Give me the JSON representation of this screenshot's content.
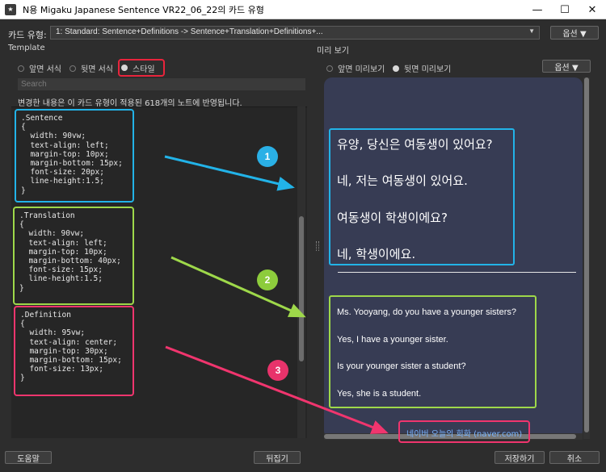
{
  "window": {
    "title": "N용 Migaku Japanese Sentence VR22_06_22의 카드 유형",
    "minimize": "—",
    "maximize": "☐",
    "close": "✕"
  },
  "note_type": {
    "label": "카드 유형:",
    "value": "1: Standard: Sentence+Definitions -> Sentence+Translation+Definitions+...",
    "options_button": "옵션 ▼"
  },
  "template": {
    "section_label": "Template",
    "radios": [
      "앞면 서식",
      "뒷면 서식",
      "스타일"
    ],
    "selected_radio": 2,
    "search_placeholder": "Search",
    "hint": "변경한 내용은 이 카드 유형이 적용된 618개의 노트에 반영됩니다.",
    "css_blocks": [
      {
        "selector": ".Sentence",
        "lines": [
          "{",
          "  width: 90vw;",
          "  text-align: left;",
          "  margin-top: 10px;",
          "  margin-bottom: 15px;",
          "  font-size: 20px;",
          "  line-height:1.5;",
          "}"
        ]
      },
      {
        "selector": ".Translation",
        "lines": [
          "{",
          "  width: 90vw;",
          "  text-align: left;",
          "  margin-top: 10px;",
          "  margin-bottom: 40px;",
          "  font-size: 15px;",
          "  line-height:1.5;",
          "}"
        ]
      },
      {
        "selector": ".Definition",
        "lines": [
          "{",
          "  width: 95vw;",
          "  text-align: center;",
          "  margin-top: 30px;",
          "  margin-bottom: 15px;",
          "  font-size: 13px;",
          "}"
        ]
      }
    ]
  },
  "preview": {
    "section_label": "미리 보기",
    "radios": [
      "앞면 미리보기",
      "뒷면 미리보기"
    ],
    "selected_radio": 1,
    "options_button": "옵션 ▼",
    "sentences": [
      "유양, 당신은 여동생이 있어요?",
      "네, 저는 여동생이 있어요.",
      "여동생이 학생이에요?",
      "네, 학생이에요."
    ],
    "translations": [
      "Ms. Yooyang, do you have a younger sisters?",
      "Yes, I have a younger sister.",
      "Is your younger sister a student?",
      "Yes, she is a student."
    ],
    "definition": "네이버 오늘의 회화 (naver.com)"
  },
  "annotations": {
    "badges": [
      "1",
      "2",
      "3"
    ],
    "colors": {
      "blue": "#22b3e8",
      "green": "#9ed84a",
      "pink": "#f0356e",
      "badge_blue": "#2ab0e6",
      "badge_green": "#8dcc3c",
      "badge_pink": "#e8336b"
    }
  },
  "footer": {
    "help": "도움말",
    "flip": "뒤집기",
    "save": "저장하기",
    "cancel": "취소"
  }
}
